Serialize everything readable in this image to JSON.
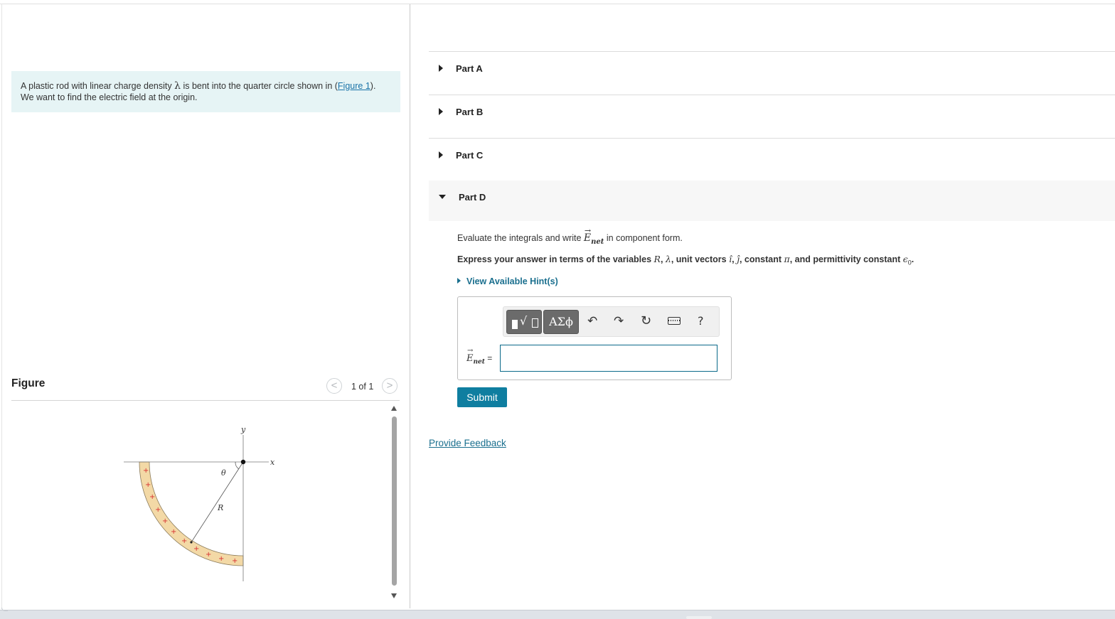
{
  "problem": {
    "intro_before_symbol": "A plastic rod with linear charge density ",
    "intro_symbol": "λ",
    "intro_after_symbol": " is bent into the quarter circle shown in (",
    "figure_link": "Figure 1",
    "intro_end": ").",
    "intro_line2": "We want to find the electric field at the origin."
  },
  "figure_panel": {
    "title": "Figure",
    "counter": "1 of 1",
    "prev_glyph": "<",
    "next_glyph": ">",
    "labels": {
      "y_axis": "y",
      "x_axis": "x",
      "theta": "θ",
      "radius": "R",
      "plus": "+"
    }
  },
  "parts": [
    {
      "label": "Part A",
      "expanded": false
    },
    {
      "label": "Part B",
      "expanded": false
    },
    {
      "label": "Part C",
      "expanded": false
    },
    {
      "label": "Part D",
      "expanded": true
    }
  ],
  "part_d": {
    "instruction_prefix": "Evaluate the integrals and write ",
    "enet_symbol": "E",
    "enet_subscript": "net",
    "instruction_suffix": " in component form.",
    "express_1": "Express your answer in terms of the variables ",
    "var_R": "R",
    "sep1": ", ",
    "var_lambda": "λ",
    "express_2": ", unit vectors ",
    "unit_i": "î",
    "sep2": ", ",
    "unit_j": "ĵ",
    "express_3": ", constant ",
    "const_pi": "π",
    "express_4": ", and permittivity constant ",
    "const_eps": "ϵ",
    "eps_sub": "0",
    "express_end": ".",
    "hint_label": "View Available Hint(s)",
    "toolbar": {
      "greek_label": "ΑΣϕ",
      "radical_glyph": "√",
      "undo_glyph": "↶",
      "redo_glyph": "↷",
      "reset_glyph": "↻",
      "help_glyph": "?"
    },
    "answer_label_symbol": "E",
    "answer_label_sub": "net",
    "answer_label_eq": " =",
    "answer_value": ""
  },
  "submit_label": "Submit",
  "feedback_label": "Provide Feedback"
}
